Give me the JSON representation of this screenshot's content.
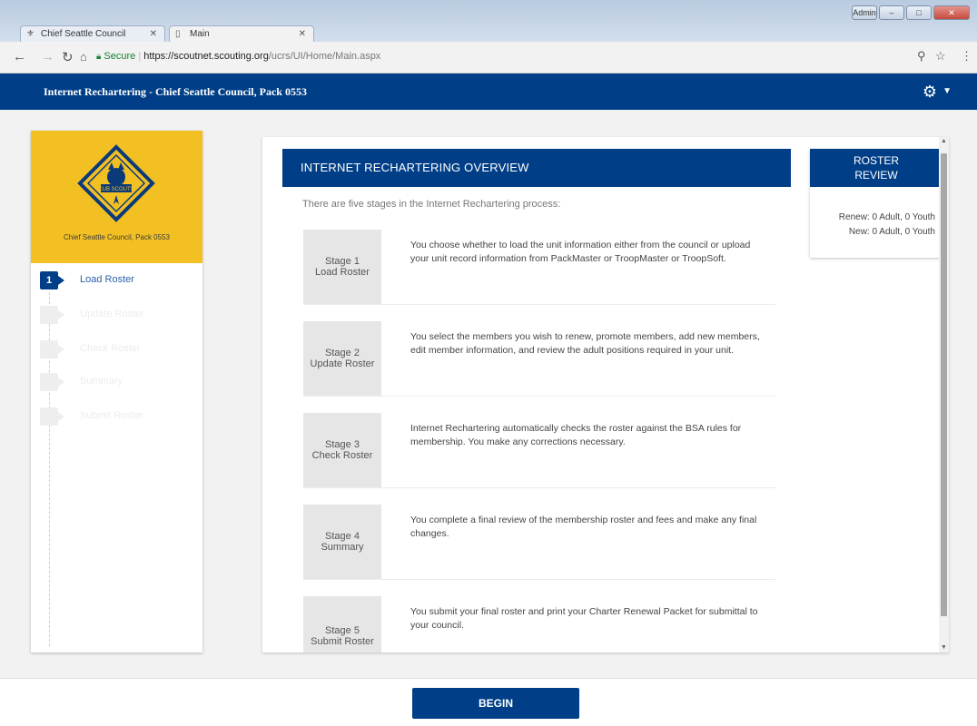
{
  "browser": {
    "tabs": [
      {
        "label": "Chief Seattle Council",
        "icon": "fleur-de-lis-icon"
      },
      {
        "label": "Main",
        "icon": "page-icon"
      }
    ],
    "secure_label": "Secure",
    "url_host": "https://scoutnet.scouting.org",
    "url_path": "/ucrs/UI/Home/Main.aspx",
    "window_user": "Admin"
  },
  "header": {
    "title": "Internet Rechartering - Chief Seattle Council, Pack 0553",
    "settings_icon": "gear-icon"
  },
  "sidebar": {
    "council_label": "Chief Seattle Council, Pack 0553",
    "logo": {
      "text": "CUB SCOUTS",
      "icon": "cub-scouts-logo"
    },
    "steps": [
      {
        "num": "1",
        "label": "Load Roster",
        "active": true
      },
      {
        "num": "2",
        "label": "Update Roster",
        "active": false
      },
      {
        "num": "3",
        "label": "Check Roster",
        "active": false
      },
      {
        "num": "4",
        "label": "Summary",
        "active": false
      },
      {
        "num": "5",
        "label": "Submit Roster",
        "active": false
      }
    ]
  },
  "overview": {
    "title": "INTERNET RECHARTERING OVERVIEW",
    "intro": "There are five stages in the Internet Rechartering process:",
    "stages": [
      {
        "name_line1": "Stage 1",
        "name_line2": "Load Roster",
        "desc": "You choose whether to load the unit information either from the council or upload your unit record information from PackMaster or TroopMaster or TroopSoft."
      },
      {
        "name_line1": "Stage 2",
        "name_line2": "Update Roster",
        "desc": "You select the members you wish to renew, promote members, add new members, edit member information, and review the adult positions required in your unit."
      },
      {
        "name_line1": "Stage 3",
        "name_line2": "Check Roster",
        "desc": "Internet Rechartering automatically checks the roster against the BSA rules for membership. You make any corrections necessary."
      },
      {
        "name_line1": "Stage 4",
        "name_line2": "Summary",
        "desc": "You complete a final review of the membership roster and fees and make any final changes."
      },
      {
        "name_line1": "Stage 5",
        "name_line2": "Submit Roster",
        "desc": "You submit your final roster and print your Charter Renewal Packet for submittal to your council."
      }
    ]
  },
  "roster_review": {
    "title_line1": "ROSTER",
    "title_line2": "REVIEW",
    "renew": "Renew: 0 Adult, 0 Youth",
    "new": "New: 0 Adult, 0 Youth"
  },
  "footer": {
    "begin_label": "BEGIN"
  },
  "colors": {
    "brand_blue": "#003f87",
    "gold": "#f3c024"
  }
}
